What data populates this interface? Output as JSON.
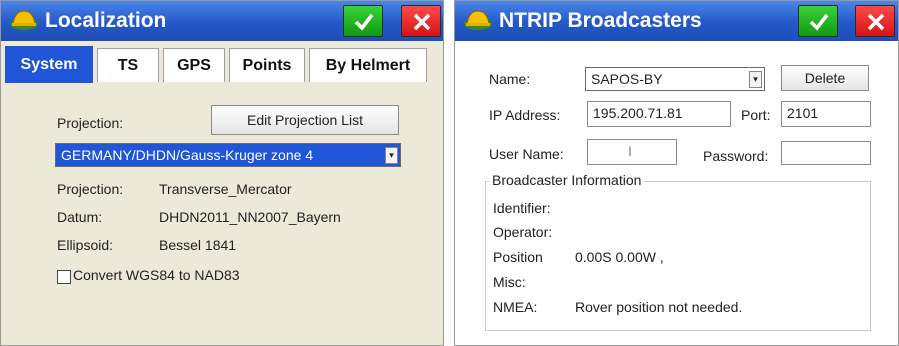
{
  "left": {
    "title": "Localization",
    "tabs": [
      {
        "label": "System",
        "active": true
      },
      {
        "label": "TS"
      },
      {
        "label": "GPS"
      },
      {
        "label": "Points"
      },
      {
        "label": "By Helmert"
      }
    ],
    "projection_label": "Projection:",
    "edit_button": "Edit Projection List",
    "projection_select": "GERMANY/DHDN/Gauss-Kruger zone 4",
    "info": [
      {
        "label": "Projection:",
        "value": "Transverse_Mercator"
      },
      {
        "label": "Datum:",
        "value": "DHDN2011_NN2007_Bayern"
      },
      {
        "label": "Ellipsoid:",
        "value": "Bessel 1841"
      }
    ],
    "checkbox_label": "Convert WGS84 to NAD83"
  },
  "right": {
    "title": "NTRIP Broadcasters",
    "name_label": "Name:",
    "name_value": "SAPOS-BY",
    "delete_button": "Delete",
    "ip_label": "IP Address:",
    "ip_value": "195.200.71.81",
    "port_label": "Port:",
    "port_value": "2101",
    "user_label": "User Name:",
    "user_value": "I",
    "password_label": "Password:",
    "password_value": "",
    "group_title": "Broadcaster Information",
    "identifier_label": "Identifier:",
    "operator_label": "Operator:",
    "position_label": "Position",
    "position_value": "0.00S 0.00W ,",
    "misc_label": "Misc:",
    "nmea_label": "NMEA:",
    "nmea_value": "Rover position not needed."
  },
  "colors": {
    "titlebar": "#2457c8",
    "ok": "#22b822",
    "cancel": "#e02020",
    "tab_active": "#1f55d6"
  },
  "icons": {
    "app": "helmet-icon",
    "ok": "check-icon",
    "cancel": "close-icon"
  }
}
